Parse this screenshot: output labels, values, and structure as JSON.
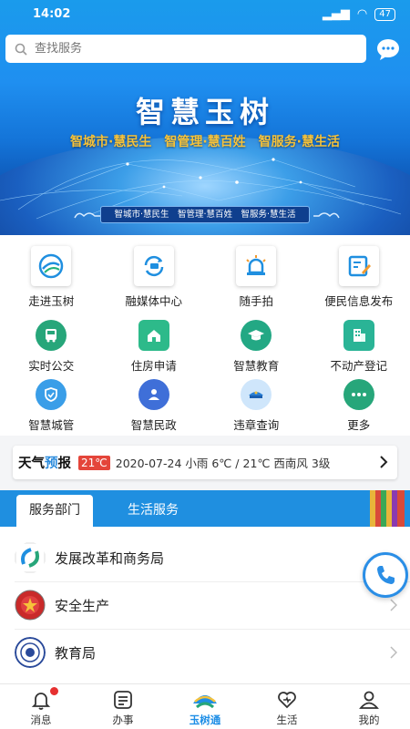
{
  "status": {
    "time": "14:02",
    "battery": "47"
  },
  "search": {
    "placeholder": "查找服务"
  },
  "banner": {
    "title": "智慧玉树",
    "subtitle": "智城市·慧民生　智管理·慧百姓　智服务·慧生活",
    "pill": "智城市·慧民生　智管理·慧百姓　智服务·慧生活"
  },
  "top_services": [
    {
      "label": "走进玉树",
      "icon": "yushu-logo-icon"
    },
    {
      "label": "融媒体中心",
      "icon": "media-refresh-icon"
    },
    {
      "label": "随手拍",
      "icon": "alarm-light-icon"
    },
    {
      "label": "便民信息发布",
      "icon": "edit-note-icon"
    }
  ],
  "services": [
    {
      "label": "实时公交",
      "icon": "bus-icon",
      "color": "#27a67a"
    },
    {
      "label": "住房申请",
      "icon": "house-icon",
      "color": "#2dba8a"
    },
    {
      "label": "智慧教育",
      "icon": "graduation-cap-icon",
      "color": "#23a884"
    },
    {
      "label": "不动产登记",
      "icon": "building-icon",
      "color": "#2ab496"
    },
    {
      "label": "智慧城管",
      "icon": "shield-icon",
      "color": "#3a9ee8"
    },
    {
      "label": "智慧民政",
      "icon": "people-icon",
      "color": "#3f6fd8"
    },
    {
      "label": "违章查询",
      "icon": "police-cap-icon",
      "color": "#cfe6fb"
    },
    {
      "label": "更多",
      "icon": "more-dots-icon",
      "color": "#27a67a"
    }
  ],
  "weather": {
    "logo_a": "天气",
    "logo_b": "预",
    "logo_c": "报",
    "temp": "21℃",
    "text": "2020-07-24 小雨 6℃ / 21℃ 西南风 3级"
  },
  "tabs": {
    "active": "服务部门",
    "inactive": "生活服务"
  },
  "departments": [
    {
      "name": "发展改革和商务局",
      "icon": "development-logo-icon"
    },
    {
      "name": "安全生产",
      "icon": "emblem-icon"
    },
    {
      "name": "教育局",
      "icon": "education-seal-icon"
    }
  ],
  "bottom_nav": [
    {
      "label": "消息",
      "icon": "bell-icon"
    },
    {
      "label": "办事",
      "icon": "list-icon"
    },
    {
      "label": "玉树通",
      "icon": "yushu-tong-icon"
    },
    {
      "label": "生活",
      "icon": "heart-icon"
    },
    {
      "label": "我的",
      "icon": "user-icon"
    }
  ],
  "colors": {
    "accent": "#1e8ee6",
    "banner": "#1f8ff0",
    "temp_badge": "#e4453a"
  }
}
